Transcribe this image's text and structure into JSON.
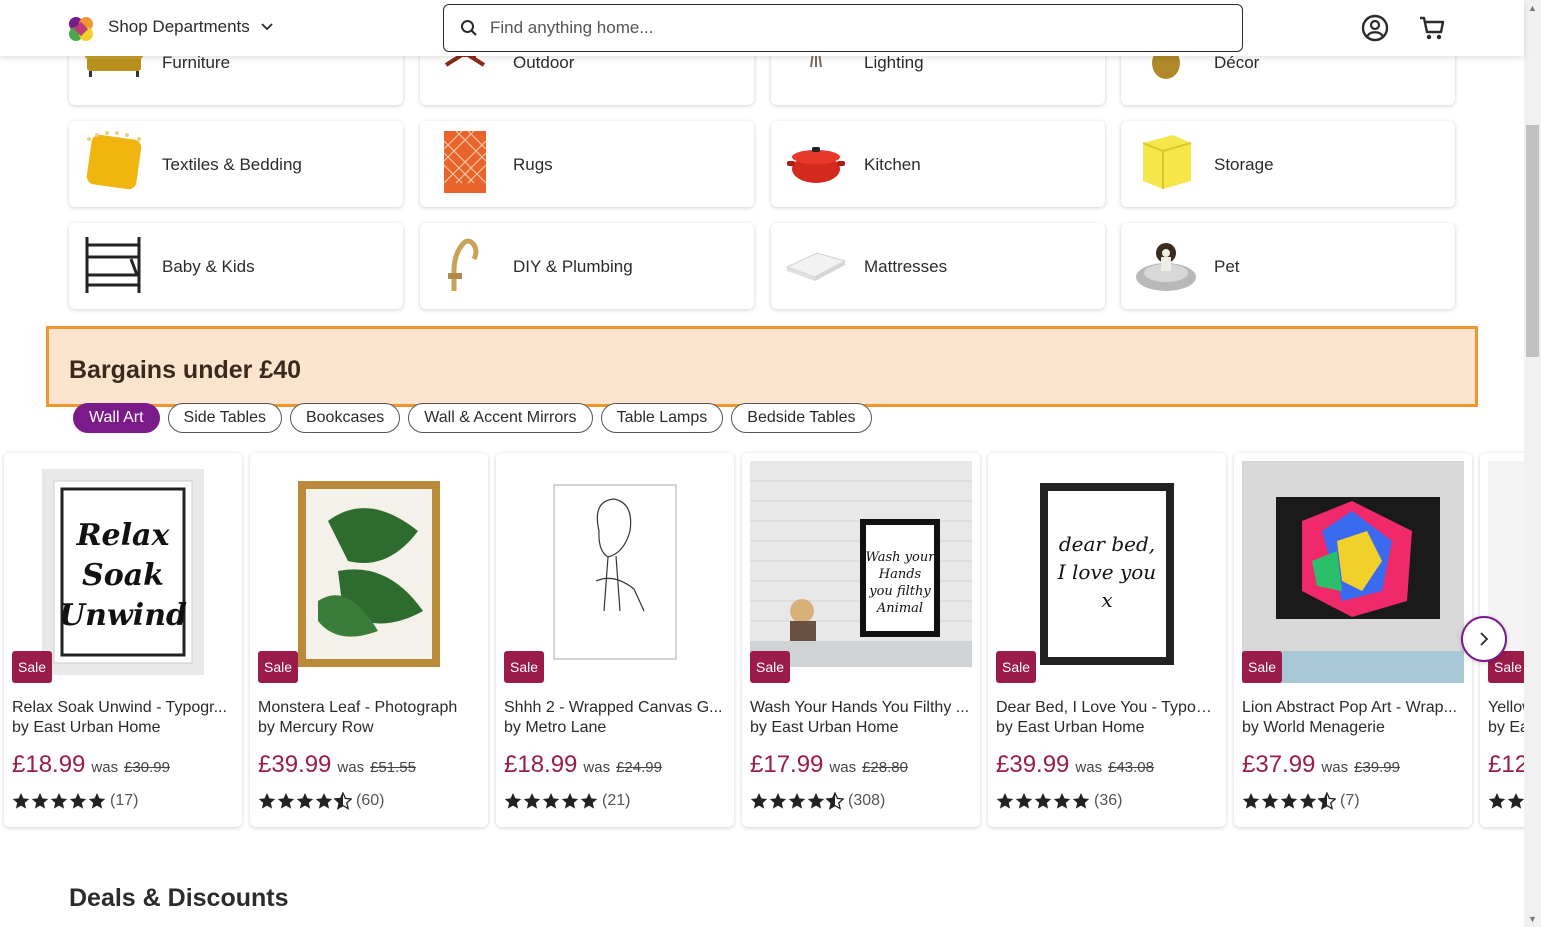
{
  "header": {
    "shop_departments_label": "Shop Departments",
    "search_placeholder": "Find anything home...",
    "icons": [
      "logo-icon",
      "chevron-down-icon",
      "search-icon",
      "account-icon",
      "cart-icon"
    ]
  },
  "departments": [
    {
      "label": "Furniture",
      "icon": "sofa-icon"
    },
    {
      "label": "Outdoor",
      "icon": "garden-chair-icon"
    },
    {
      "label": "Lighting",
      "icon": "floor-lamp-icon"
    },
    {
      "label": "Décor",
      "icon": "vase-icon"
    },
    {
      "label": "Textiles & Bedding",
      "icon": "cushion-icon"
    },
    {
      "label": "Rugs",
      "icon": "rug-icon"
    },
    {
      "label": "Kitchen",
      "icon": "casserole-pot-icon"
    },
    {
      "label": "Storage",
      "icon": "storage-box-icon"
    },
    {
      "label": "Baby & Kids",
      "icon": "bunk-bed-icon"
    },
    {
      "label": "DIY & Plumbing",
      "icon": "tap-icon"
    },
    {
      "label": "Mattresses",
      "icon": "mattress-icon"
    },
    {
      "label": "Pet",
      "icon": "pet-bed-icon"
    }
  ],
  "bargains": {
    "title": "Bargains under £40",
    "chips": [
      {
        "label": "Wall Art",
        "active": true
      },
      {
        "label": "Side Tables",
        "active": false
      },
      {
        "label": "Bookcases",
        "active": false
      },
      {
        "label": "Wall & Accent Mirrors",
        "active": false
      },
      {
        "label": "Table Lamps",
        "active": false
      },
      {
        "label": "Bedside Tables",
        "active": false
      }
    ],
    "sale_label": "Sale",
    "was_label": "was",
    "products": [
      {
        "name": "Relax Soak Unwind - Typogr...",
        "brand": "by East Urban Home",
        "price": "£18.99",
        "old_price": "£30.99",
        "rating": 5,
        "reviews": "(17)",
        "art_text": [
          "Relax",
          "Soak",
          "Unwind"
        ]
      },
      {
        "name": "Monstera Leaf - Photograph",
        "brand": "by Mercury Row",
        "price": "£39.99",
        "old_price": "£51.55",
        "rating": 4.5,
        "reviews": "(60)"
      },
      {
        "name": "Shhh 2 - Wrapped Canvas G...",
        "brand": "by Metro Lane",
        "price": "£18.99",
        "old_price": "£24.99",
        "rating": 5,
        "reviews": "(21)"
      },
      {
        "name": "Wash Your Hands You Filthy ...",
        "brand": "by East Urban Home",
        "price": "£17.99",
        "old_price": "£28.80",
        "rating": 4.5,
        "reviews": "(308)",
        "art_text": [
          "Wash your",
          "Hands",
          "you filthy",
          "Animal"
        ]
      },
      {
        "name": "Dear Bed, I Love You - Typog...",
        "brand": "by East Urban Home",
        "price": "£39.99",
        "old_price": "£43.08",
        "rating": 5,
        "reviews": "(36)",
        "art_text": [
          "dear bed,",
          "I love you",
          "x"
        ]
      },
      {
        "name": "Lion Abstract Pop Art - Wrap...",
        "brand": "by World Menagerie",
        "price": "£37.99",
        "old_price": "£39.99",
        "rating": 4.5,
        "reviews": "(7)"
      },
      {
        "name": "Yellow",
        "brand": "by Ea",
        "price": "£12",
        "old_price": "",
        "rating": 5,
        "reviews": ""
      }
    ]
  },
  "deals": {
    "title": "Deals & Discounts"
  },
  "colors": {
    "accent_purple": "#7b1b8a",
    "sale_red": "#9b1b4a",
    "bargains_bg": "#fde4cf",
    "bargains_border": "#f0962f"
  }
}
